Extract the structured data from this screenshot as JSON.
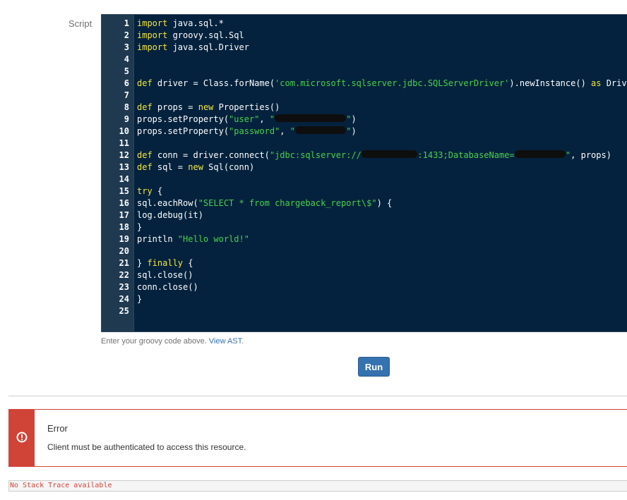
{
  "script_label": "Script",
  "editor": {
    "lines": [
      [
        {
          "k": "kw",
          "t": "import"
        },
        {
          "t": " java.sql.*"
        }
      ],
      [
        {
          "k": "kw",
          "t": "import"
        },
        {
          "t": " groovy.sql.Sql"
        }
      ],
      [
        {
          "k": "kw",
          "t": "import"
        },
        {
          "t": " java.sql.Driver"
        }
      ],
      [],
      [],
      [
        {
          "k": "kw",
          "t": "def"
        },
        {
          "t": " driver = Class.forName("
        },
        {
          "k": "str",
          "t": "'com.microsoft.sqlserver.jdbc.SQLServerDriver'"
        },
        {
          "t": ").newInstance() "
        },
        {
          "k": "kw",
          "t": "as"
        },
        {
          "t": " Driver"
        }
      ],
      [],
      [
        {
          "k": "kw",
          "t": "def"
        },
        {
          "t": " props = "
        },
        {
          "k": "kw",
          "t": "new"
        },
        {
          "t": " Properties()"
        }
      ],
      [
        {
          "t": "props.setProperty("
        },
        {
          "k": "str",
          "t": "\"user\""
        },
        {
          "t": ", "
        },
        {
          "k": "str",
          "t": "\""
        },
        {
          "k": "red",
          "t": "xxxxxxxxxxxxxx"
        },
        {
          "k": "str",
          "t": "\""
        },
        {
          "t": ")"
        }
      ],
      [
        {
          "t": "props.setProperty("
        },
        {
          "k": "str",
          "t": "\"password\""
        },
        {
          "t": ", "
        },
        {
          "k": "str",
          "t": "\""
        },
        {
          "k": "red",
          "t": "xxxxxxxxxx"
        },
        {
          "k": "str",
          "t": "\""
        },
        {
          "t": ")"
        }
      ],
      [],
      [
        {
          "k": "kw",
          "t": "def"
        },
        {
          "t": " conn = driver.connect("
        },
        {
          "k": "str",
          "t": "\"jdbc:sqlserver://"
        },
        {
          "k": "red",
          "t": "xxxxxxxxxxx"
        },
        {
          "k": "str",
          "t": ":1433;DatabaseName="
        },
        {
          "k": "red",
          "t": "xxxxxxxxxx"
        },
        {
          "k": "str",
          "t": "\""
        },
        {
          "t": ", props)"
        }
      ],
      [
        {
          "k": "kw",
          "t": "def"
        },
        {
          "t": " sql = "
        },
        {
          "k": "kw",
          "t": "new"
        },
        {
          "t": " Sql(conn)"
        }
      ],
      [],
      [
        {
          "k": "kw",
          "t": "try"
        },
        {
          "t": " {"
        }
      ],
      [
        {
          "t": "sql.eachRow("
        },
        {
          "k": "str",
          "t": "\"SELECT * from chargeback_report\\$\""
        },
        {
          "t": ") {"
        }
      ],
      [
        {
          "t": "log.debug(it)"
        }
      ],
      [
        {
          "t": "}"
        }
      ],
      [
        {
          "t": "println "
        },
        {
          "k": "str",
          "t": "\"Hello world!\""
        }
      ],
      [],
      [
        {
          "t": "} "
        },
        {
          "k": "kw",
          "t": "finally"
        },
        {
          "t": " {"
        }
      ],
      [
        {
          "t": "sql.close()"
        }
      ],
      [
        {
          "t": "conn.close()"
        }
      ],
      [
        {
          "t": "}"
        }
      ],
      []
    ]
  },
  "hint": {
    "text": "Enter your groovy code above. ",
    "link": "View AST",
    "suffix": "."
  },
  "run_label": "Run",
  "error": {
    "icon": "error-circle-icon",
    "title": "Error",
    "message": "Client must be authenticated to access this resource."
  },
  "stack_trace": "No Stack Trace available",
  "colors": {
    "editor_bg": "#04223d",
    "gutter_bg": "#1f3951",
    "keyword": "#f5e63b",
    "string": "#45d34a",
    "button": "#3572b0",
    "error": "#d04437"
  }
}
